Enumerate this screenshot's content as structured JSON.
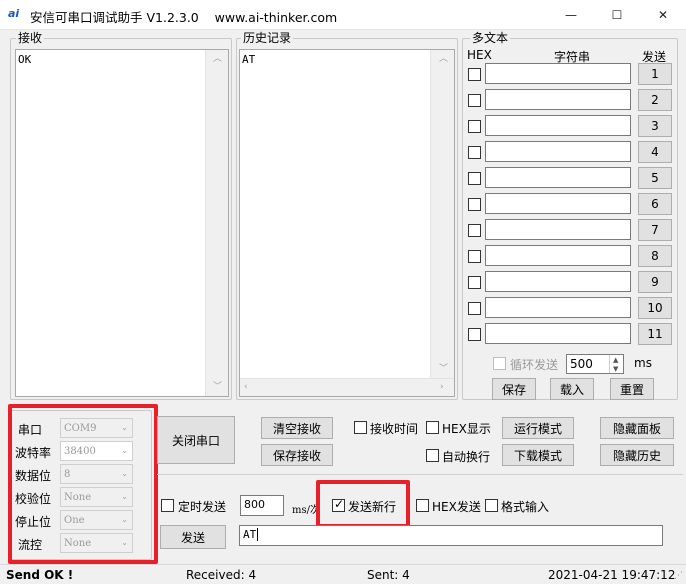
{
  "window": {
    "icon_text": "ai",
    "title": "安信可串口调试助手 V1.2.3.0",
    "url": "www.ai-thinker.com",
    "minimize": "—",
    "maximize": "☐",
    "close": "✕"
  },
  "receive": {
    "label": "接收",
    "content": "OK"
  },
  "history": {
    "label": "历史记录",
    "content": "AT"
  },
  "multi_text": {
    "label": "多文本",
    "col_hex": "HEX",
    "col_string": "字符串",
    "col_send": "发送",
    "rows": [
      "1",
      "2",
      "3",
      "4",
      "5",
      "6",
      "7",
      "8",
      "9",
      "10",
      "11"
    ],
    "loop_send_label": "循环发送",
    "loop_interval": "500",
    "loop_unit": "ms",
    "save": "保存",
    "load": "载入",
    "reset": "重置"
  },
  "serial": {
    "port_label": "串口",
    "port_value": "COM9",
    "baud_label": "波特率",
    "baud_value": "38400",
    "databits_label": "数据位",
    "databits_value": "8",
    "parity_label": "校验位",
    "parity_value": "None",
    "stopbits_label": "停止位",
    "stopbits_value": "One",
    "flow_label": "流控",
    "flow_value": "None",
    "close_port": "关闭串口"
  },
  "controls": {
    "clear_receive": "清空接收",
    "save_receive": "保存接收",
    "receive_time": "接收时间",
    "hex_display": "HEX显示",
    "auto_wrap": "自动换行",
    "run_mode": "运行模式",
    "download_mode": "下载模式",
    "hide_panel": "隐藏面板",
    "hide_history": "隐藏历史"
  },
  "send": {
    "timed_send": "定时发送",
    "interval": "800",
    "interval_unit": "ms/次",
    "send_newline": "发送新行",
    "hex_send": "HEX发送",
    "format_input": "格式输入",
    "send_button": "发送",
    "input_value": "AT"
  },
  "status": {
    "message": "Send OK !",
    "received": "Received: 4",
    "sent": "Sent: 4",
    "datetime": "2021-04-21 19:47:12"
  },
  "colors": {
    "highlight": "#e8202a"
  }
}
